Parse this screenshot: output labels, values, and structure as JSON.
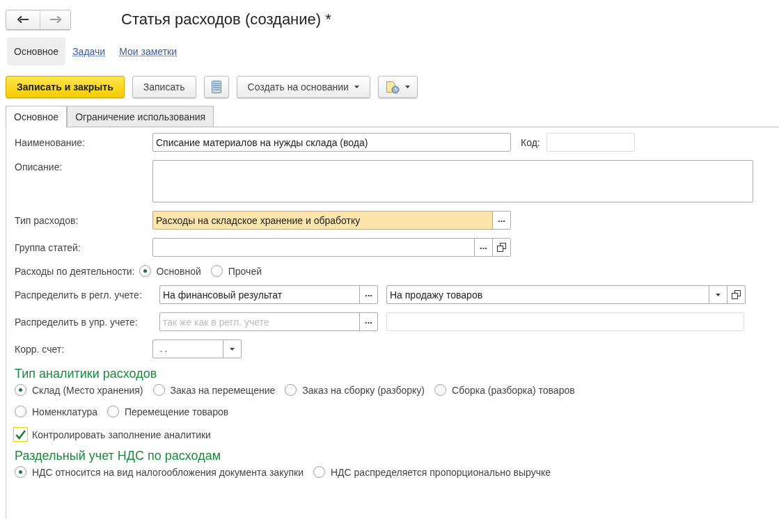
{
  "window": {
    "title": "Статья расходов (создание) *"
  },
  "nav_links": [
    {
      "label": "Основное",
      "selected": true
    },
    {
      "label": "Задачи",
      "selected": false
    },
    {
      "label": "Мои заметки",
      "selected": false
    }
  ],
  "toolbar": [
    {
      "kind": "primary",
      "label": "Записать и закрыть"
    },
    {
      "kind": "plain",
      "label": "Записать"
    },
    {
      "kind": "list-icon"
    },
    {
      "kind": "menu",
      "label": "Создать на основании"
    },
    {
      "kind": "report-menu"
    }
  ],
  "tabs": [
    {
      "label": "Основное",
      "selected": true
    },
    {
      "label": "Ограничение использования",
      "selected": false
    }
  ],
  "name": {
    "label": "Наименование:",
    "value": "Списание материалов на нужды склада (вода)"
  },
  "code": {
    "label": "Код:"
  },
  "description": {
    "label": "Описание:"
  },
  "expense_type": {
    "label": "Тип расходов:",
    "value": "Расходы на складское хранение и обработку",
    "highlighted": true,
    "select_button": "..."
  },
  "article_group": {
    "label": "Группа статей:",
    "select_button": "..."
  },
  "activity": {
    "label": "Расходы по деятельности:",
    "options": [
      {
        "label": "Основной",
        "selected": true
      },
      {
        "label": "Прочей",
        "selected": false
      }
    ]
  },
  "distribute_regl": {
    "label": "Распределить в регл. учете:",
    "value": "На финансовый результат",
    "target": "На продажу товаров",
    "select_button": "..."
  },
  "distribute_mgmt": {
    "label": "Распределить в упр. учете:",
    "placeholder": "так же как в регл. учете",
    "select_button": "..."
  },
  "corr_account": {
    "label": "Корр. счет:",
    "value": ". ."
  },
  "analytics": {
    "title": "Тип аналитики расходов",
    "rows": [
      [
        {
          "label": "Склад (Место хранения)",
          "selected": true
        },
        {
          "label": "Заказ на перемещение",
          "selected": false
        },
        {
          "label": "Заказ на сборку (разборку)",
          "selected": false
        },
        {
          "label": "Сборка (разборка) товаров",
          "selected": false
        }
      ],
      [
        {
          "label": "Номенклатура",
          "selected": false
        },
        {
          "label": "Перемещение товаров",
          "selected": false
        }
      ]
    ],
    "control": {
      "label": "Контролировать заполнение аналитики",
      "checked": true
    }
  },
  "vat": {
    "title": "Раздельный учет НДС по расходам",
    "options": [
      {
        "label": "НДС относится на вид налогообложения документа закупки",
        "selected": true
      },
      {
        "label": "НДС распределяется пропорционально выручке",
        "selected": false
      }
    ]
  }
}
